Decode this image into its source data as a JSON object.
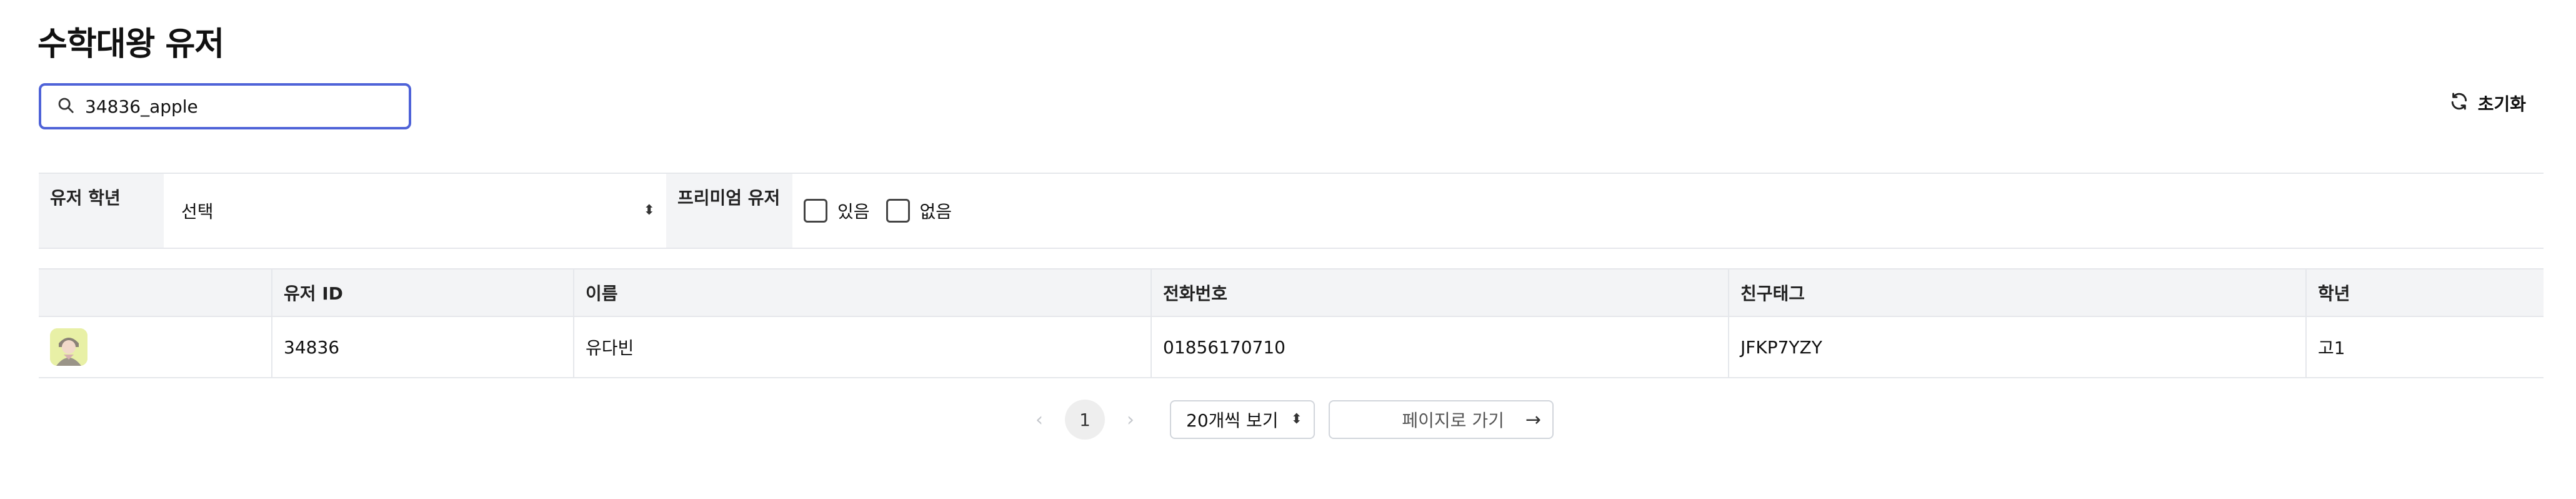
{
  "page": {
    "title": "수학대왕 유저"
  },
  "search": {
    "value": "34836_apple",
    "icon": "search-icon"
  },
  "reset": {
    "label": "초기화",
    "icon": "refresh-icon"
  },
  "filters": {
    "grade_label": "유저 학년",
    "grade_value": "선택",
    "premium_label": "프리미엄 유저",
    "options": [
      "있음",
      "없음"
    ]
  },
  "table": {
    "columns": [
      "",
      "유저 ID",
      "이름",
      "전화번호",
      "친구태그",
      "학년"
    ],
    "rows": [
      {
        "avatar": "avatar-image",
        "user_id": "34836",
        "name": "유다빈",
        "phone": "01856170710",
        "friend_tag": "JFKP7YZY",
        "grade": "고1"
      }
    ]
  },
  "pagination": {
    "prev": "‹",
    "current_page": "1",
    "next": "›",
    "page_size": "20개씩 보기",
    "goto_placeholder": "페이지로 가기",
    "goto_arrow": "→"
  },
  "colors": {
    "focus_border": "#4f63d8",
    "header_bg": "#f3f4f6",
    "avatar_bg": "#e8f0a6"
  }
}
